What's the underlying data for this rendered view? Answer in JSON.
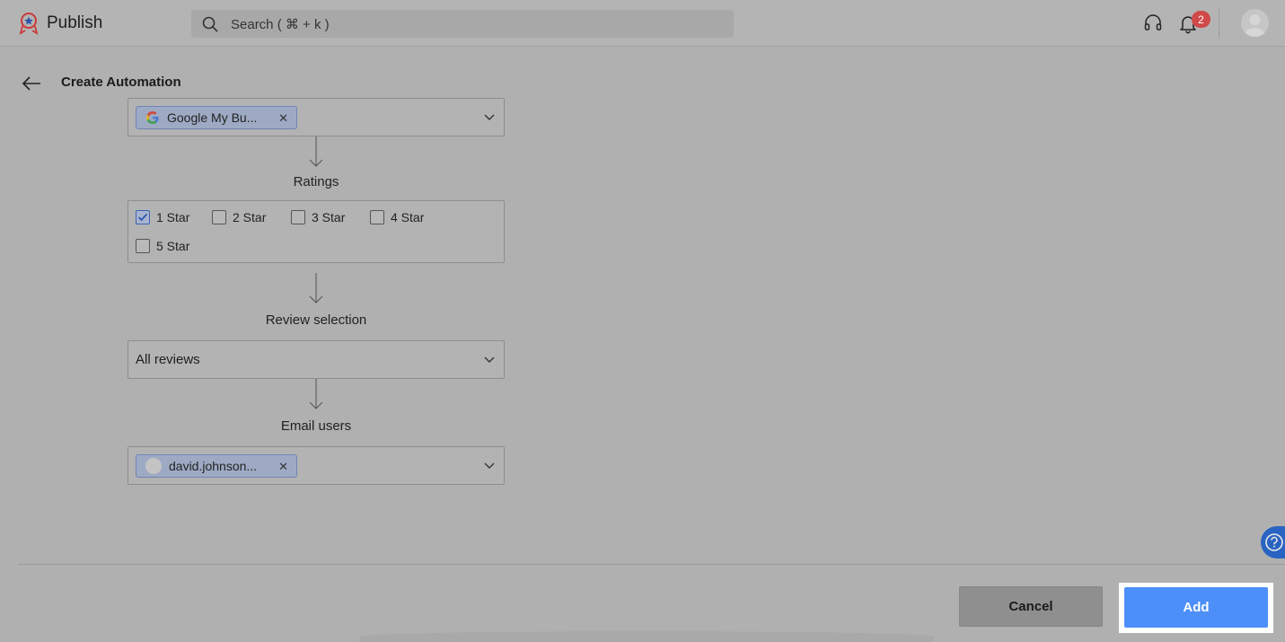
{
  "app": {
    "name": "Publish"
  },
  "search": {
    "placeholder": "Search ( ⌘ + k )"
  },
  "notifications": {
    "count": "2"
  },
  "page": {
    "title": "Create Automation"
  },
  "source": {
    "chip_label": "Google My Bu..."
  },
  "ratings": {
    "label": "Ratings",
    "options": [
      {
        "label": "1 Star",
        "checked": true
      },
      {
        "label": "2 Star",
        "checked": false
      },
      {
        "label": "3 Star",
        "checked": false
      },
      {
        "label": "4 Star",
        "checked": false
      },
      {
        "label": "5 Star",
        "checked": false
      }
    ]
  },
  "review_selection": {
    "label": "Review selection",
    "value": "All reviews"
  },
  "email_users": {
    "label": "Email users",
    "chip_label": "david.johnson..."
  },
  "footer": {
    "cancel_label": "Cancel",
    "add_label": "Add"
  },
  "colors": {
    "accent": "#4d8ff8",
    "badge": "#d04a4a",
    "help": "#2a64c2"
  },
  "icons": [
    "publish-logo-icon",
    "search-icon",
    "headset-icon",
    "bell-icon",
    "avatar",
    "back-arrow-icon",
    "google-icon",
    "chevron-down-icon",
    "close-icon",
    "check-icon",
    "arrow-down-icon",
    "help-icon"
  ]
}
